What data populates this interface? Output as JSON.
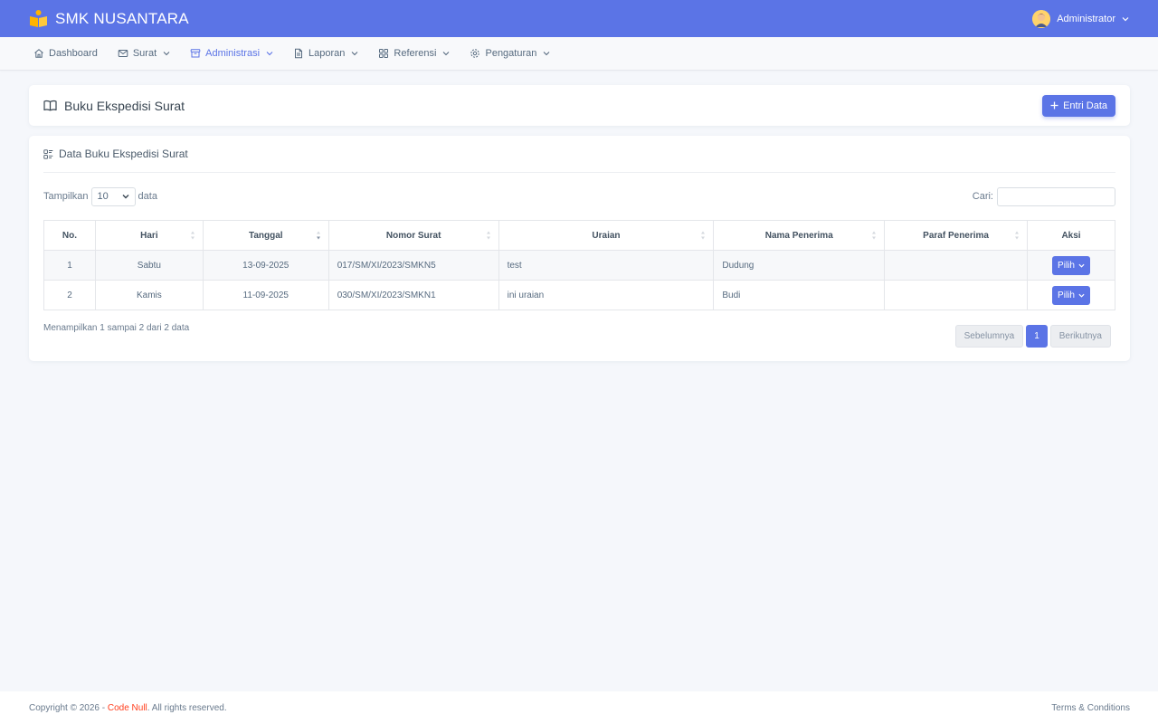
{
  "app": {
    "brand": "SMK NUSANTARA",
    "user": "Administrator"
  },
  "colors": {
    "primary": "#5b74e6",
    "accent": "#ff3e1d",
    "logo": "#ffb400"
  },
  "nav": [
    {
      "label": "Dashboard",
      "icon": "home-icon"
    },
    {
      "label": "Surat",
      "icon": "mail-icon"
    },
    {
      "label": "Administrasi",
      "icon": "archive-icon",
      "active": true
    },
    {
      "label": "Laporan",
      "icon": "document-icon"
    },
    {
      "label": "Referensi",
      "icon": "grid-icon"
    },
    {
      "label": "Pengaturan",
      "icon": "gear-icon"
    }
  ],
  "page": {
    "title": "Buku Ekspedisi Surat",
    "entry_button": "Entri Data"
  },
  "table_card": {
    "title": "Data Buku Ekspedisi Surat",
    "show_prefix": "Tampilkan",
    "show_value": "10",
    "show_suffix": "data",
    "search_label": "Cari:",
    "search_value": "",
    "columns": [
      "No.",
      "Hari",
      "Tanggal",
      "Nomor Surat",
      "Uraian",
      "Nama Penerima",
      "Paraf Penerima",
      "Aksi"
    ],
    "rows": [
      {
        "no": "1",
        "hari": "Sabtu",
        "tanggal": "13-09-2025",
        "nomor": "017/SM/XI/2023/SMKN5",
        "uraian": "test",
        "penerima": "Dudung",
        "paraf": "",
        "aksi": "Pilih"
      },
      {
        "no": "2",
        "hari": "Kamis",
        "tanggal": "11-09-2025",
        "nomor": "030/SM/XI/2023/SMKN1",
        "uraian": "ini uraian",
        "penerima": "Budi",
        "paraf": "",
        "aksi": "Pilih"
      }
    ],
    "info": "Menampilkan 1 sampai 2 dari 2 data",
    "pager": {
      "prev": "Sebelumnya",
      "current": "1",
      "next": "Berikutnya"
    }
  },
  "footer": {
    "copyright_prefix": "Copyright © 2026 - ",
    "brand": "Code Null",
    "copyright_suffix": ". All rights reserved.",
    "terms": "Terms & Conditions"
  }
}
